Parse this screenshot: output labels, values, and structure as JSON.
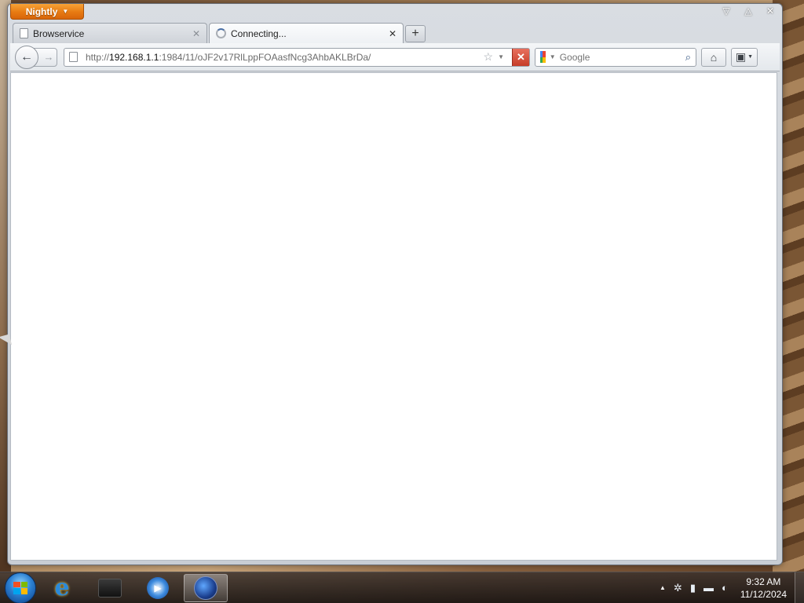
{
  "app": {
    "menu_button_label": "Nightly",
    "window_controls": [
      "▽",
      "△",
      "✕"
    ]
  },
  "tabs": [
    {
      "title": "Browservice",
      "active": false
    },
    {
      "title": "Connecting...",
      "active": true
    }
  ],
  "nav": {
    "url_prefix": "http://",
    "url_host": "192.168.1.1",
    "url_rest": ":1984/11/oJF2v17RlLppFOAasfNcg3AhbAKLBrDa/",
    "stop_glyph": "✕"
  },
  "search": {
    "engine": "Google",
    "placeholder": "Google"
  },
  "taskbar": {
    "time": "9:32 AM",
    "date": "11/12/2024"
  },
  "colors": {
    "app_button": "#e77a12",
    "stop_button": "#c63c28"
  }
}
